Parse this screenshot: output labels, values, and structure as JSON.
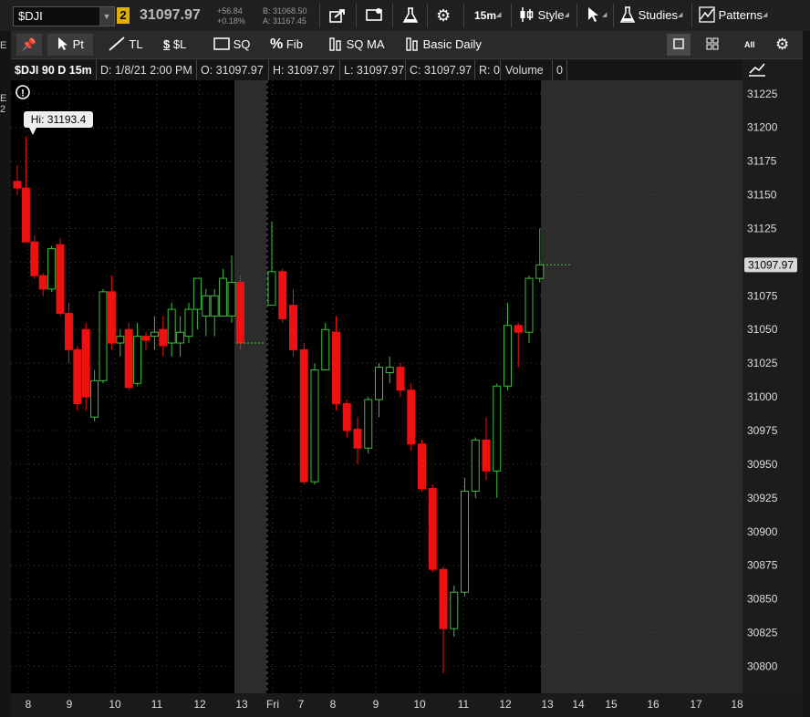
{
  "toolbar": {
    "symbol": "$DJI",
    "link_badge": "2",
    "last_price": "31097.97",
    "net_change": "+56.84",
    "pct_change": "+0.18%",
    "bid": "B: 31068.50",
    "ask": "A: 31167.45",
    "interval": "15m",
    "style_label": "Style",
    "studies_label": "Studies",
    "patterns_label": "Patterns",
    "icons": [
      "share-icon",
      "alert-icon",
      "flask-icon",
      "gear-icon",
      "candles-icon",
      "cursor-icon",
      "studies-flask-icon",
      "patterns-icon"
    ]
  },
  "drawing_tools": {
    "pointer": "Pt",
    "trendline": "TL",
    "price_level": "$L",
    "square": "SQ",
    "fibonacci": "Fib",
    "sq_ma": "SQ MA",
    "basic_daily": "Basic Daily",
    "layout_all": "All"
  },
  "info_bar": {
    "title": "$DJI 90 D 15m",
    "date": "D: 1/8/21 2:00 PM",
    "open": "O: 31097.97",
    "high": "H: 31097.97",
    "low": "L: 31097.97",
    "close": "C: 31097.97",
    "range": "R: 0",
    "volume_label": "Volume",
    "volume_value": "0"
  },
  "left_edge_glyphs": [
    "E",
    "E 2"
  ],
  "chart_data": {
    "type": "candlestick",
    "price_axis_ticks": [
      31225,
      31200,
      31175,
      31150,
      31125,
      31100,
      31075,
      31050,
      31025,
      31000,
      30975,
      30950,
      30925,
      30900,
      30875,
      30850,
      30825,
      30800
    ],
    "ylim": [
      30780,
      31235
    ],
    "time_axis_labels": [
      "8",
      "9",
      "10",
      "11",
      "12",
      "13",
      "Fri",
      "7",
      "8",
      "9",
      "10",
      "11",
      "12",
      "13",
      "14",
      "15",
      "16",
      "17",
      "18"
    ],
    "current_price_label": "31097.97",
    "high_bubble": "Hi: 31193.4",
    "colors": {
      "up": "#38c038",
      "down": "#ee1111",
      "background": "#000000",
      "offhours": "#2c2c2c",
      "grid": "#3a3a3a"
    },
    "candles": [
      {
        "o": 31160,
        "h": 31172,
        "l": 31150,
        "c": 31155
      },
      {
        "o": 31155,
        "h": 31193.4,
        "l": 31145,
        "c": 31115
      },
      {
        "o": 31115,
        "h": 31120,
        "l": 31088,
        "c": 31090
      },
      {
        "o": 31090,
        "h": 31092,
        "l": 31075,
        "c": 31080
      },
      {
        "o": 31080,
        "h": 31112,
        "l": 31078,
        "c": 31110
      },
      {
        "o": 31113,
        "h": 31118,
        "l": 31060,
        "c": 31062
      },
      {
        "o": 31062,
        "h": 31070,
        "l": 31025,
        "c": 31035
      },
      {
        "o": 31035,
        "h": 31038,
        "l": 30990,
        "c": 30995
      },
      {
        "o": 31050,
        "h": 31055,
        "l": 30990,
        "c": 31000
      },
      {
        "o": 30985,
        "h": 31020,
        "l": 30982,
        "c": 31012
      },
      {
        "o": 31012,
        "h": 31080,
        "l": 31010,
        "c": 31078
      },
      {
        "o": 31078,
        "h": 31090,
        "l": 31035,
        "c": 31040
      },
      {
        "o": 31040,
        "h": 31050,
        "l": 31030,
        "c": 31045
      },
      {
        "o": 31050,
        "h": 31055,
        "l": 31005,
        "c": 31007
      },
      {
        "o": 31010,
        "h": 31055,
        "l": 31008,
        "c": 31045
      },
      {
        "o": 31045,
        "h": 31048,
        "l": 31035,
        "c": 31042
      },
      {
        "o": 31045,
        "h": 31060,
        "l": 31035,
        "c": 31048
      },
      {
        "o": 31050,
        "h": 31060,
        "l": 31030,
        "c": 31038
      },
      {
        "o": 31040,
        "h": 31070,
        "l": 31030,
        "c": 31065
      },
      {
        "o": 31040,
        "h": 31060,
        "l": 31030,
        "c": 31048
      },
      {
        "o": 31045,
        "h": 31070,
        "l": 31040,
        "c": 31065
      },
      {
        "o": 31065,
        "h": 31085,
        "l": 31050,
        "c": 31088
      },
      {
        "o": 31060,
        "h": 31080,
        "l": 31045,
        "c": 31075
      },
      {
        "o": 31060,
        "h": 31080,
        "l": 31045,
        "c": 31075
      },
      {
        "o": 31060,
        "h": 31095,
        "l": 31060,
        "c": 31088
      },
      {
        "o": 31060,
        "h": 31105,
        "l": 31055,
        "c": 31085
      },
      {
        "o": 31085,
        "h": 31090,
        "l": 31035,
        "c": 31040
      },
      {
        "o": 31068,
        "h": 31130,
        "l": 31068,
        "c": 31093
      },
      {
        "o": 31093,
        "h": 31095,
        "l": 31055,
        "c": 31058
      },
      {
        "o": 31068,
        "h": 31080,
        "l": 31030,
        "c": 31035
      },
      {
        "o": 31035,
        "h": 31040,
        "l": 30935,
        "c": 30937
      },
      {
        "o": 30937,
        "h": 31025,
        "l": 30935,
        "c": 31020
      },
      {
        "o": 31020,
        "h": 31055,
        "l": 31020,
        "c": 31050
      },
      {
        "o": 31048,
        "h": 31060,
        "l": 30990,
        "c": 30995
      },
      {
        "o": 30995,
        "h": 30998,
        "l": 30970,
        "c": 30975
      },
      {
        "o": 30976,
        "h": 30985,
        "l": 30950,
        "c": 30962
      },
      {
        "o": 30962,
        "h": 31000,
        "l": 30958,
        "c": 30998
      },
      {
        "o": 30998,
        "h": 31025,
        "l": 30985,
        "c": 31022
      },
      {
        "o": 31018,
        "h": 31030,
        "l": 31010,
        "c": 31022
      },
      {
        "o": 31022,
        "h": 31025,
        "l": 31000,
        "c": 31005
      },
      {
        "o": 31005,
        "h": 31010,
        "l": 30960,
        "c": 30965
      },
      {
        "o": 30965,
        "h": 30968,
        "l": 30930,
        "c": 30932
      },
      {
        "o": 30932,
        "h": 30935,
        "l": 30870,
        "c": 30872
      },
      {
        "o": 30872,
        "h": 30874,
        "l": 30795,
        "c": 30828
      },
      {
        "o": 30828,
        "h": 30860,
        "l": 30822,
        "c": 30855
      },
      {
        "o": 30855,
        "h": 30940,
        "l": 30852,
        "c": 30930
      },
      {
        "o": 30930,
        "h": 30970,
        "l": 30925,
        "c": 30968
      },
      {
        "o": 30968,
        "h": 30985,
        "l": 30938,
        "c": 30945
      },
      {
        "o": 30945,
        "h": 31010,
        "l": 30925,
        "c": 31008
      },
      {
        "o": 31008,
        "h": 31070,
        "l": 31005,
        "c": 31053
      },
      {
        "o": 31053,
        "h": 31055,
        "l": 31022,
        "c": 31048
      },
      {
        "o": 31048,
        "h": 31090,
        "l": 31040,
        "c": 31088
      },
      {
        "o": 31088,
        "h": 31125,
        "l": 31085,
        "c": 31098
      }
    ]
  }
}
